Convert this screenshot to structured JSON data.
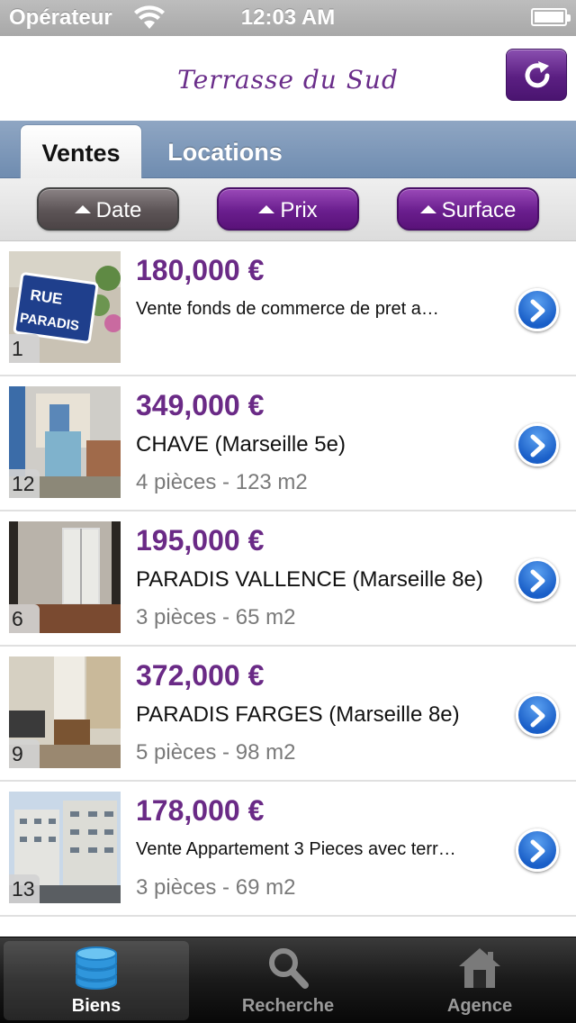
{
  "status_bar": {
    "carrier": "Opérateur",
    "time": "12:03 AM"
  },
  "header": {
    "logo_text": "Terrasse du Sud",
    "refresh_icon": "refresh-icon"
  },
  "tabs": [
    {
      "label": "Ventes",
      "active": true
    },
    {
      "label": "Locations",
      "active": false
    }
  ],
  "sort": {
    "date": "Date",
    "prix": "Prix",
    "surface": "Surface"
  },
  "colors": {
    "accent": "#6a2a86",
    "list_price": "#6a2a86",
    "disclosure": "#1a5fc8"
  },
  "listings": [
    {
      "count": "1",
      "price": "180,000 €",
      "title": "Vente fonds de commerce de pret a…",
      "details": ""
    },
    {
      "count": "12",
      "price": "349,000 €",
      "title": "CHAVE (Marseille 5e)",
      "details": "4 pièces - 123 m2"
    },
    {
      "count": "6",
      "price": "195,000 €",
      "title": "PARADIS VALLENCE (Marseille 8e)",
      "details": "3 pièces - 65 m2"
    },
    {
      "count": "9",
      "price": "372,000 €",
      "title": "PARADIS FARGES (Marseille 8e)",
      "details": "5 pièces - 98 m2"
    },
    {
      "count": "13",
      "price": "178,000 €",
      "title": "Vente Appartement 3 Pieces avec terr…",
      "details": "3 pièces - 69 m2"
    }
  ],
  "thumb_sign_text": [
    "RUE",
    "PARADIS"
  ],
  "tabbar": {
    "biens": "Biens",
    "recherche": "Recherche",
    "agence": "Agence"
  }
}
